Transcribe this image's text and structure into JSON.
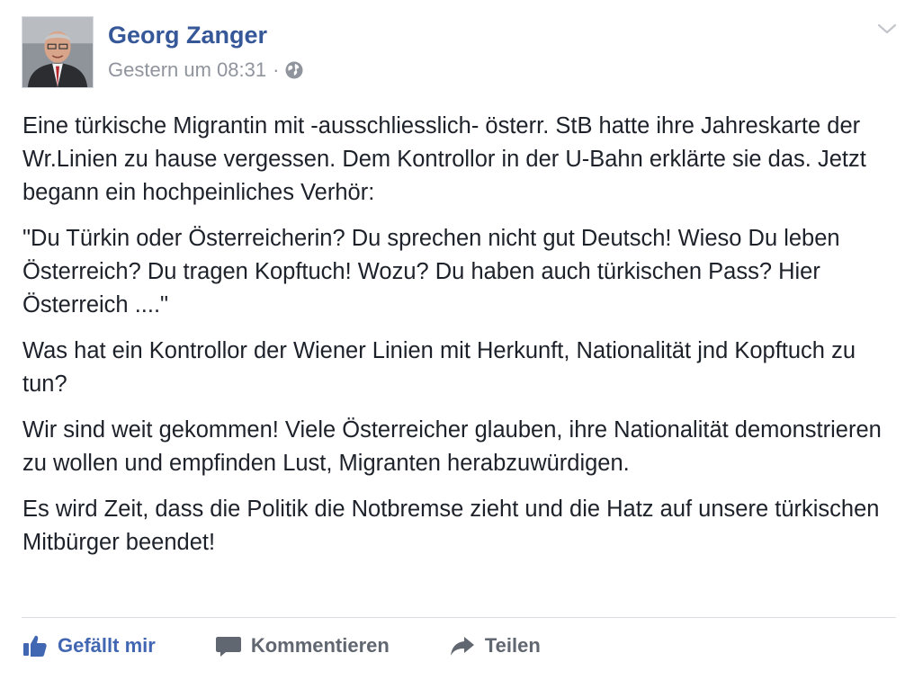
{
  "post": {
    "author": "Georg Zanger",
    "timestamp": "Gestern um 08:31",
    "separator": "·",
    "privacy_icon": "globe-icon",
    "menu_icon": "chevron-down-icon",
    "paragraphs": [
      "Eine türkische Migrantin mit -ausschliesslich- österr. StB hatte ihre Jahreskarte der Wr.Linien zu hause vergessen. Dem Kontrollor in der U-Bahn erklärte sie das. Jetzt begann ein hochpeinliches Verhör:",
      "\"Du Türkin oder Österreicherin? Du sprechen nicht gut Deutsch! Wieso Du leben Österreich? Du tragen Kopftuch! Wozu? Du haben auch türkischen Pass? Hier Österreich ....\"",
      "Was hat ein Kontrollor der Wiener Linien mit Herkunft, Nationalität jnd Kopftuch zu tun?",
      "Wir sind weit gekommen! Viele Österreicher glauben, ihre Nationalität demonstrieren zu wollen und empfinden Lust, Migranten herabzuwürdigen.",
      "Es wird Zeit, dass die Politik die Notbremse zieht und die Hatz auf unsere türkischen Mitbürger beendet!"
    ]
  },
  "actions": {
    "like_label": "Gefällt mir",
    "comment_label": "Kommentieren",
    "share_label": "Teilen"
  },
  "colors": {
    "author_link": "#365899",
    "like_active": "#4267b2",
    "meta_text": "#90949c",
    "body_text": "#1d2129",
    "action_text": "#616770"
  }
}
